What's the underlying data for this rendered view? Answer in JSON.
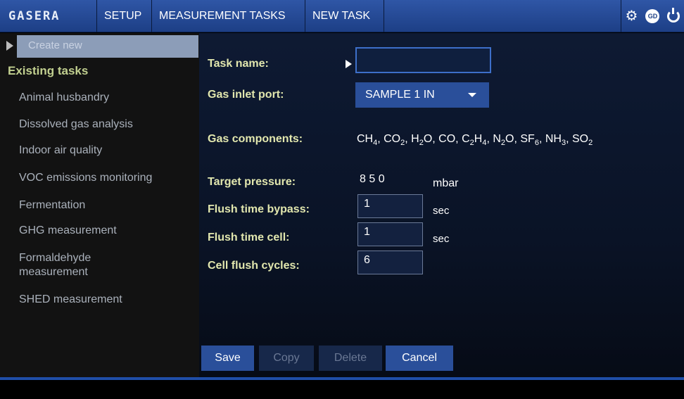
{
  "topbar": {
    "logo": "GASERA",
    "setup": "SETUP",
    "measurement_tasks": "MEASUREMENT TASKS",
    "new_task": "NEW TASK",
    "gd_badge": "GD",
    "icons": [
      "gear-icon",
      "gd-badge-icon",
      "power-icon"
    ]
  },
  "sidebar": {
    "create_new": "Create new",
    "existing_title": "Existing tasks",
    "items": [
      {
        "label": "Animal husbandry"
      },
      {
        "label": "Dissolved gas analysis"
      },
      {
        "label": "Indoor air quality"
      },
      {
        "label": "VOC emissions monitoring"
      },
      {
        "label": "Fermentation"
      },
      {
        "label": "GHG measurement"
      },
      {
        "label": "Formaldehyde measurement"
      },
      {
        "label": "SHED measurement"
      }
    ]
  },
  "form": {
    "task_name_label": "Task name:",
    "task_name_value": "",
    "gas_inlet_label": "Gas inlet port:",
    "gas_inlet_value": "SAMPLE 1 IN",
    "gas_components_label": "Gas components:",
    "gas_components": [
      {
        "base": "CH",
        "sub": "4"
      },
      {
        "base": "CO",
        "sub": "2"
      },
      {
        "base": "H",
        "sub": "2",
        "tail": "O"
      },
      {
        "base": "CO",
        "sub": ""
      },
      {
        "base": "C",
        "sub": "2",
        "tail": "H",
        "sub2": "4"
      },
      {
        "base": "N",
        "sub": "2",
        "tail": "O"
      },
      {
        "base": "SF",
        "sub": "6"
      },
      {
        "base": "NH",
        "sub": "3"
      },
      {
        "base": "SO",
        "sub": "2"
      }
    ],
    "target_pressure_label": "Target pressure:",
    "target_pressure_value": "8 5 0",
    "target_pressure_unit": "mbar",
    "flush_bypass_label": "Flush time bypass:",
    "flush_bypass_value": "1",
    "flush_bypass_unit": "sec",
    "flush_cell_label": "Flush time cell:",
    "flush_cell_value": "1",
    "flush_cell_unit": "sec",
    "cell_cycles_label": "Cell flush cycles:",
    "cell_cycles_value": "6"
  },
  "buttons": {
    "save": "Save",
    "copy": "Copy",
    "delete": "Delete",
    "cancel": "Cancel"
  },
  "colors": {
    "accent_blue": "#2a4f9a",
    "label_yellow": "#e2e7ae",
    "existing_green": "#c2d090"
  }
}
